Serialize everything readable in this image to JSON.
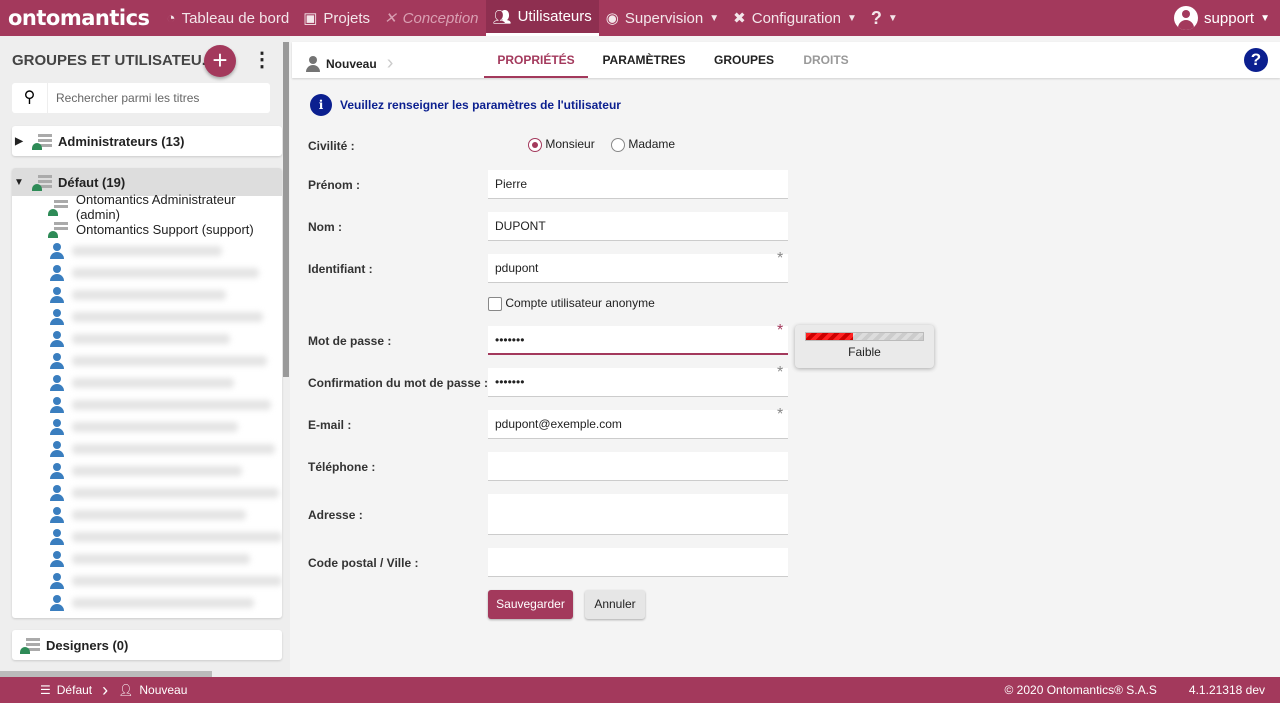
{
  "topbar": {
    "logo": "ontomantics",
    "nav": [
      {
        "label": "Tableau de bord",
        "icon": "gauge-icon"
      },
      {
        "label": "Projets",
        "icon": "toolbox-icon"
      },
      {
        "label": "Conception",
        "icon": "tools-icon",
        "disabled": true
      },
      {
        "label": "Utilisateurs",
        "icon": "users-icon",
        "active": true
      },
      {
        "label": "Supervision",
        "icon": "eye-icon",
        "dropdown": true
      },
      {
        "label": "Configuration",
        "icon": "wrench-icon",
        "dropdown": true
      },
      {
        "label": "?",
        "icon": "help-icon",
        "dropdown": true
      }
    ],
    "user": "support"
  },
  "sidebar": {
    "title": "GROUPES ET UTILISATEU...",
    "search_placeholder": "Rechercher parmi les titres",
    "groups": [
      {
        "label": "Administrateurs (13)",
        "expanded": false
      },
      {
        "label": "Défaut (19)",
        "expanded": true
      },
      {
        "label": "Designers (0)"
      }
    ],
    "default_members": [
      "Ontomantics Administrateur (admin)",
      "Ontomantics Support (support)"
    ],
    "hidden_member_count_shown": 17
  },
  "main": {
    "breadcrumb": "Nouveau",
    "tabs": [
      {
        "label": "PROPRIÉTÉS",
        "active": true
      },
      {
        "label": "PARAMÈTRES"
      },
      {
        "label": "GROUPES"
      },
      {
        "label": "DROITS",
        "disabled": true
      }
    ],
    "info": "Veuillez renseigner les paramètres de l'utilisateur",
    "form": {
      "civilite_label": "Civilité :",
      "civilite_options": [
        "Monsieur",
        "Madame"
      ],
      "civilite_selected": "Monsieur",
      "prenom_label": "Prénom :",
      "prenom": "Pierre",
      "nom_label": "Nom :",
      "nom": "DUPONT",
      "identifiant_label": "Identifiant :",
      "identifiant": "pdupont",
      "anonyme_label": "Compte utilisateur anonyme",
      "anonyme_checked": false,
      "password_label": "Mot de passe :",
      "password": "•••••••",
      "confirm_label": "Confirmation du mot de passe :",
      "confirm": "•••••••",
      "email_label": "E-mail :",
      "email": "pdupont@exemple.com",
      "tel_label": "Téléphone :",
      "tel": "",
      "adresse_label": "Adresse :",
      "adresse": "",
      "cp_label": "Code postal / Ville :",
      "cp": "",
      "required_mark": "*",
      "strength": {
        "label": "Faible",
        "percent": 40
      }
    },
    "save": "Sauvegarder",
    "cancel": "Annuler"
  },
  "footer": {
    "crumbs": [
      "Défaut",
      "Nouveau"
    ],
    "copyright": "© 2020 Ontomantics® S.A.S",
    "version": "4.1.21318 dev"
  },
  "colors": {
    "brand": "#a3395c",
    "info": "#0b1f8f"
  }
}
